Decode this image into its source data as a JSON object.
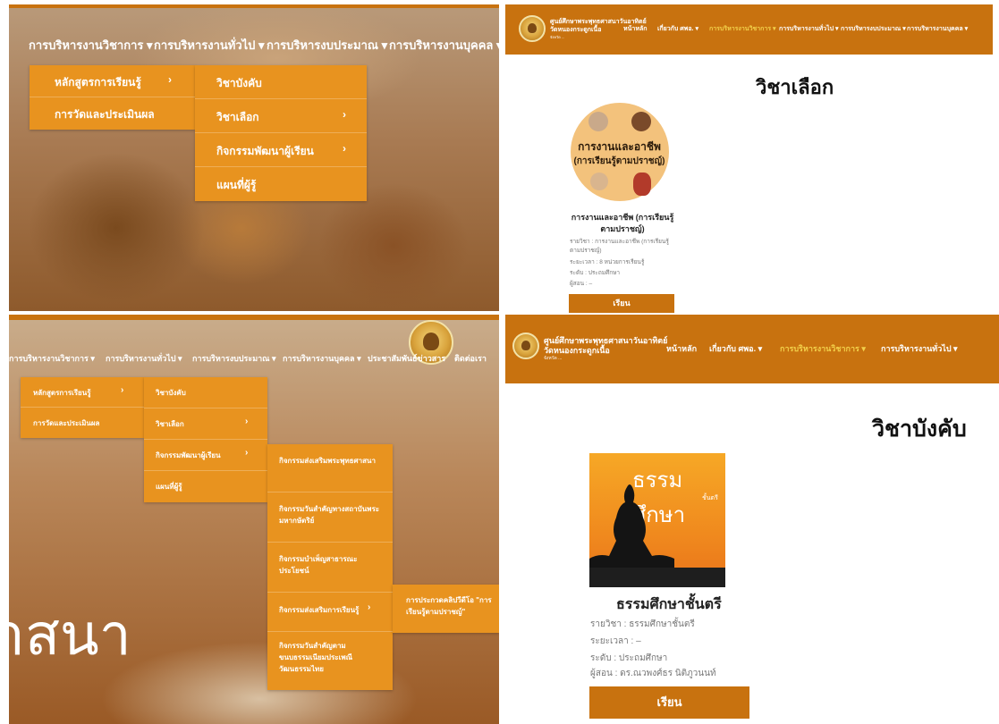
{
  "panel1": {
    "nav": [
      "การบริหารงานวิชาการ ▾",
      "การบริหารงานทั่วไป ▾",
      "การบริหารงบประมาณ ▾",
      "การบริหารงานบุคคล ▾"
    ],
    "menu_l1": [
      "หลักสูตรการเรียนรู้",
      "การวัดและประเมินผล"
    ],
    "menu_l2": [
      "วิชาบังคับ",
      "วิชาเลือก",
      "กิจกรรมพัฒนาผู้เรียน",
      "แผนที่ผู้รู้"
    ]
  },
  "panel2": {
    "org_line1": "ศูนย์ศึกษาพระพุทธศาสนาวันอาทิตย์",
    "org_line2": "วัดหนองกระดูกเนื้อ",
    "org_line3": "จังหวัด ...",
    "nav": [
      "หน้าหลัก",
      "เกี่ยวกับ ศพอ. ▾",
      "การบริหารงานวิชาการ ▾",
      "การบริหารงานทั่วไป ▾",
      "การบริหารงบประมาณ ▾",
      "การบริหารงานบุคคล ▾"
    ],
    "heading": "วิชาเลือก",
    "cover_title_1": "การงานและอาชีพ",
    "cover_title_2": "(การเรียนรู้ตามปราชญ์)",
    "course_title": "การงานและอาชีพ (การเรียนรู้ตามปราชญ์)",
    "details": [
      "รายวิชา : การงานและอาชีพ (การเรียนรู้ตามปราชญ์)",
      "ระยะเวลา : 8 หน่วยการเรียนรู้",
      "ระดับ : ประถมศึกษา",
      "ผู้สอน : –"
    ],
    "button": "เรียน"
  },
  "panel3": {
    "nav": [
      "การบริหารงานวิชาการ ▾",
      "การบริหารงานทั่วไป ▾",
      "การบริหารงบประมาณ ▾",
      "การบริหารงานบุคคล ▾",
      "ประชาสัมพันธ์ข่าวสาร",
      "ติดต่อเรา"
    ],
    "menu_l1": [
      "หลักสูตรการเรียนรู้",
      "การวัดและประเมินผล"
    ],
    "menu_l2": [
      "วิชาบังคับ",
      "วิชาเลือก",
      "กิจกรรมพัฒนาผู้เรียน",
      "แผนที่ผู้รู้"
    ],
    "menu_l3": [
      "กิจกรรมส่งเสริมพระพุทธศาสนา",
      "กิจกรรมวันสำคัญทางสถาบันพระมหากษัตริย์",
      "กิจกรรมบำเพ็ญสาธารณะประโยชน์",
      "กิจกรรมส่งเสริมการเรียนรู้",
      "กิจกรรมวันสำคัญตามขนบธรรมเนียมประเพณีวัฒนธรรมไทย"
    ],
    "menu_l4": [
      "การประกวดคลิปวีดีโอ \"การเรียนรู้ตามปราชญ์\""
    ],
    "big_text": "าสนา"
  },
  "panel4": {
    "org_line1": "ศูนย์ศึกษาพระพุทธศาสนาวันอาทิตย์",
    "org_line2": "วัดหนองกระดูกเนื้อ",
    "org_line3": "จังหวัด ...",
    "nav": [
      "หน้าหลัก",
      "เกี่ยวกับ ศพอ. ▾",
      "การบริหารงานวิชาการ ▾",
      "การบริหารงานทั่วไป ▾"
    ],
    "heading": "วิชาบังคับ",
    "cover_title": "ธรรมศึกษา",
    "cover_sub": "ชั้นตรี",
    "course_title": "ธรรมศึกษาชั้นตรี",
    "details": [
      "รายวิชา : ธรรมศึกษาชั้นตรี",
      "ระยะเวลา : –",
      "ระดับ : ประถมศึกษา",
      "ผู้สอน : ดร.ณวพงศ์ธร นิติภูวนนท์"
    ],
    "button": "เรียน"
  },
  "colors": {
    "nav_orange": "#c8720f",
    "menu_orange": "#e8931f",
    "active_nav": "#f2d04a"
  }
}
